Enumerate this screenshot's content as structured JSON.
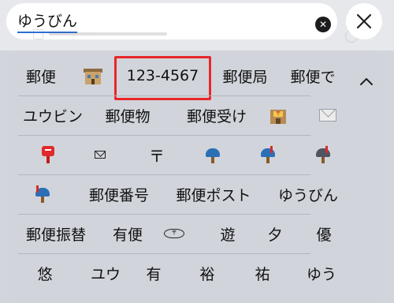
{
  "search": {
    "query": "ゆうびん",
    "clear_icon": "clear-circle-icon",
    "close_icon": "close-x-icon"
  },
  "candidates": {
    "row1": [
      "郵便",
      "building-icon",
      "123-4567",
      "郵便局",
      "郵便で"
    ],
    "row2": [
      "ユウビン",
      "郵便物",
      "郵便受け",
      "post-office-icon",
      "envelope-icon"
    ],
    "row3": [
      "postbox-red-icon",
      "envelope-outline-icon",
      "〒",
      "mailbox-closed-icon",
      "mailbox-flag-icon",
      "mailbox-dark-icon"
    ],
    "row4": [
      "mailbox-open-icon",
      "郵便番号",
      "郵便ポスト",
      "ゆうびん"
    ],
    "row5": [
      "郵便振替",
      "有便",
      "postal-mark-icon",
      "遊",
      "夕",
      "優"
    ],
    "row6": [
      "悠",
      "ユウ",
      "有",
      "裕",
      "祐",
      "ゆう"
    ]
  },
  "symbols": {
    "postal_mark": "〒",
    "postal_circle": "〒"
  },
  "colors": {
    "highlight": "#e8262a",
    "caret": "#2f6fd6"
  }
}
